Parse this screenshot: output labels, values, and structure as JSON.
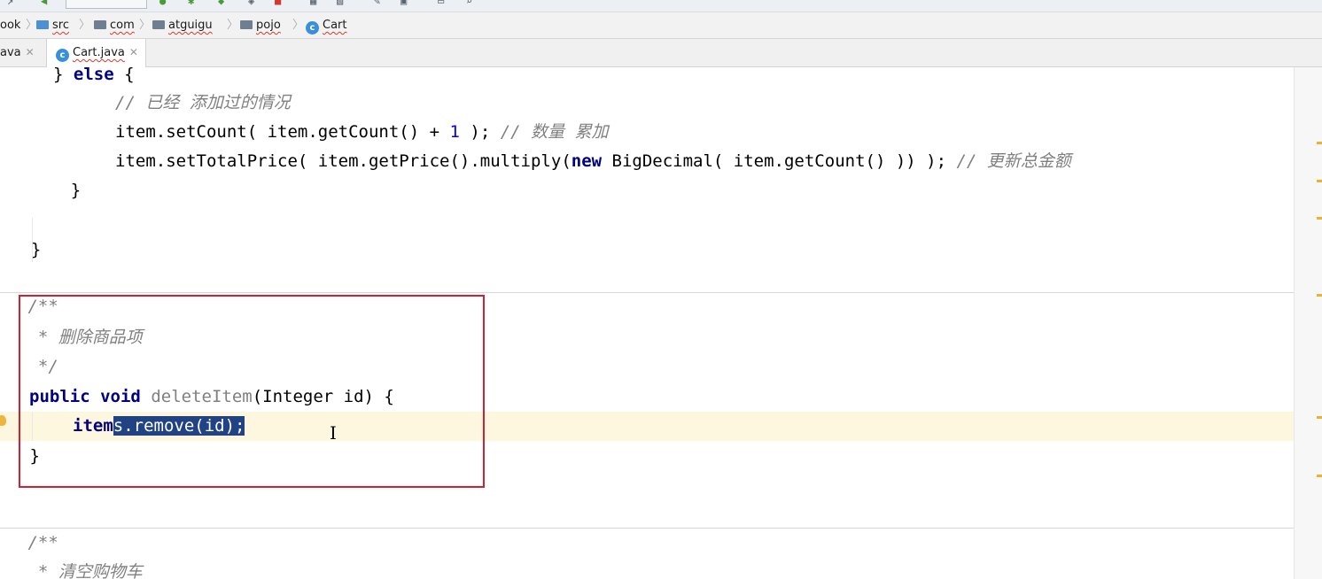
{
  "breadcrumb": [
    {
      "label": "ook",
      "icon": "module-icon"
    },
    {
      "label": "src",
      "icon": "folder-icon"
    },
    {
      "label": "com",
      "icon": "package-icon"
    },
    {
      "label": "atguigu",
      "icon": "package-icon"
    },
    {
      "label": "pojo",
      "icon": "package-icon"
    },
    {
      "label": "Cart",
      "icon": "class-icon"
    }
  ],
  "tabs": [
    {
      "label": "ava",
      "active": false
    },
    {
      "label": "Cart.java",
      "active": true
    }
  ],
  "code": {
    "l1": {
      "indent": "    ",
      "open": "} ",
      "kw": "else",
      "close": " {"
    },
    "l2": {
      "indent": "      ",
      "comment": "// 已经 添加过的情况"
    },
    "l3": {
      "indent": "      ",
      "a": "item.setCount( item.getCount() + ",
      "num": "1",
      "b": " ); ",
      "comment": "// 数量 累加"
    },
    "l4": {
      "indent": "      ",
      "a": "item.setTotalPrice( item.getPrice().multiply(",
      "kw": "new",
      "b": " BigDecimal( item.getCount() )) ); ",
      "comment": "// 更新总金额"
    },
    "l5": {
      "text": "    }"
    },
    "l7": {
      "text": "  }"
    },
    "l8": {
      "text": " /**"
    },
    "l9": {
      "text": "  * 删除商品项"
    },
    "l10": {
      "text": "  */"
    },
    "l11": {
      "kw1": "public",
      "kw2": "void",
      "name": "deleteItem",
      "rest": "(Integer id) {"
    },
    "l12": {
      "indent": "    ",
      "plain": "item",
      "sel": "s.remove(id);"
    },
    "l13": {
      "text": " }"
    },
    "l15": {
      "text": " /**"
    },
    "l16": {
      "text": "  * 清空购物车"
    }
  }
}
